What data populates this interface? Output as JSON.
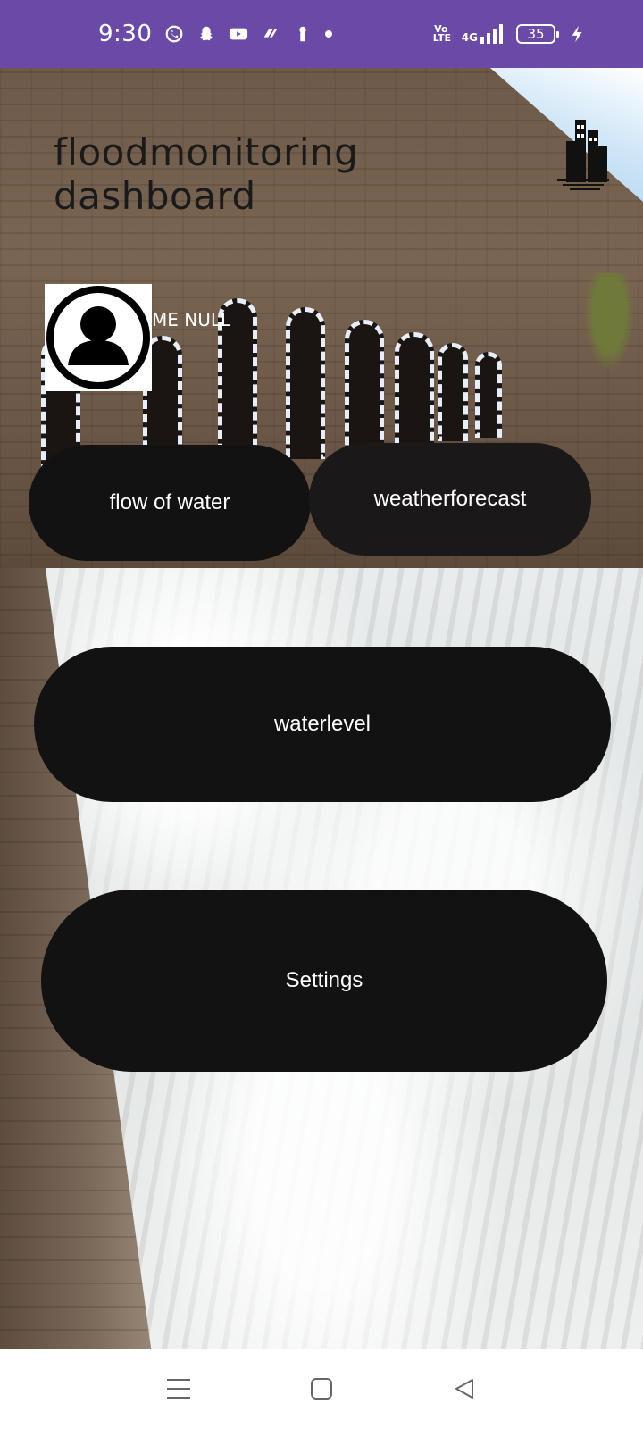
{
  "status_bar": {
    "time": "9:30",
    "volte": "Vo LTE",
    "network": "4G",
    "battery": "35",
    "notification_icons": [
      "whatsapp-icon",
      "snapchat-icon",
      "youtube-icon",
      "app-icon",
      "keyhole-icon",
      "dot-icon"
    ]
  },
  "header": {
    "title": "floodmonitoring dashboard",
    "logo_icon": "city-buildings-icon"
  },
  "profile": {
    "avatar_icon": "user-avatar-icon",
    "name": "ME NULL"
  },
  "buttons": {
    "flow": "flow of water",
    "weather": "weatherforecast",
    "waterlevel": "waterlevel",
    "settings": "Settings"
  },
  "nav": {
    "recents_icon": "menu-icon",
    "home_icon": "home-square-icon",
    "back_icon": "back-triangle-icon"
  },
  "colors": {
    "status_bar": "#6a4aa6",
    "button": "#121212",
    "button_text": "#ffffff",
    "title": "#1a1a1a"
  }
}
